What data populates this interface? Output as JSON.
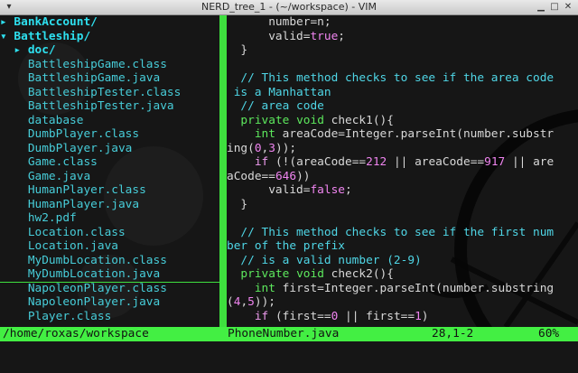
{
  "window": {
    "title": "NERD_tree_1 - (~/workspace) - VIM"
  },
  "tree": {
    "items": [
      {
        "text": "▸ BankAccount/",
        "kind": "dir"
      },
      {
        "text": "▾ Battleship/",
        "kind": "dir"
      },
      {
        "text": "  ▸ doc/",
        "kind": "dir"
      },
      {
        "text": "    BattleshipGame.class",
        "kind": "file"
      },
      {
        "text": "    BattleshipGame.java",
        "kind": "file"
      },
      {
        "text": "    BattleshipTester.class",
        "kind": "file"
      },
      {
        "text": "    BattleshipTester.java",
        "kind": "file"
      },
      {
        "text": "    database",
        "kind": "file"
      },
      {
        "text": "    DumbPlayer.class",
        "kind": "file"
      },
      {
        "text": "    DumbPlayer.java",
        "kind": "file"
      },
      {
        "text": "    Game.class",
        "kind": "file"
      },
      {
        "text": "    Game.java",
        "kind": "file"
      },
      {
        "text": "    HumanPlayer.class",
        "kind": "file"
      },
      {
        "text": "    HumanPlayer.java",
        "kind": "file"
      },
      {
        "text": "    hw2.pdf",
        "kind": "file"
      },
      {
        "text": "    Location.class",
        "kind": "file"
      },
      {
        "text": "    Location.java",
        "kind": "file"
      },
      {
        "text": "    MyDumbLocation.class",
        "kind": "file"
      },
      {
        "text": "    MyDumbLocation.java",
        "kind": "file"
      },
      {
        "text": "    NapoleonPlayer.class",
        "kind": "file"
      },
      {
        "text": "    NapoleonPlayer.java",
        "kind": "file"
      },
      {
        "text": "    Player.class",
        "kind": "file"
      }
    ]
  },
  "code": {
    "lines": [
      [
        {
          "t": "      number=n;",
          "c": "code"
        }
      ],
      [
        {
          "t": "      valid=",
          "c": "code"
        },
        {
          "t": "true",
          "c": "bool"
        },
        {
          "t": ";",
          "c": "code"
        }
      ],
      [
        {
          "t": "  }",
          "c": "code"
        }
      ],
      [
        {
          "t": "",
          "c": "code"
        }
      ],
      [
        {
          "t": "  // This method checks to see if the area code",
          "c": "comment"
        }
      ],
      [
        {
          "t": " is a Manhattan",
          "c": "comment"
        }
      ],
      [
        {
          "t": "  // area code",
          "c": "comment"
        }
      ],
      [
        {
          "t": "  ",
          "c": "code"
        },
        {
          "t": "private",
          "c": "type"
        },
        {
          "t": " ",
          "c": "code"
        },
        {
          "t": "void",
          "c": "type"
        },
        {
          "t": " check1(){",
          "c": "code"
        }
      ],
      [
        {
          "t": "    ",
          "c": "code"
        },
        {
          "t": "int",
          "c": "type"
        },
        {
          "t": " areaCode=Integer.parseInt(number.substr",
          "c": "code"
        }
      ],
      [
        {
          "t": "ing(",
          "c": "code"
        },
        {
          "t": "0",
          "c": "num"
        },
        {
          "t": ",",
          "c": "code"
        },
        {
          "t": "3",
          "c": "num"
        },
        {
          "t": "));",
          "c": "code"
        }
      ],
      [
        {
          "t": "    ",
          "c": "code"
        },
        {
          "t": "if",
          "c": "keyword"
        },
        {
          "t": " (!(areaCode==",
          "c": "code"
        },
        {
          "t": "212",
          "c": "num"
        },
        {
          "t": " || areaCode==",
          "c": "code"
        },
        {
          "t": "917",
          "c": "num"
        },
        {
          "t": " || are",
          "c": "code"
        }
      ],
      [
        {
          "t": "aCode==",
          "c": "code"
        },
        {
          "t": "646",
          "c": "num"
        },
        {
          "t": "))",
          "c": "code"
        }
      ],
      [
        {
          "t": "      valid=",
          "c": "code"
        },
        {
          "t": "false",
          "c": "bool"
        },
        {
          "t": ";",
          "c": "code"
        }
      ],
      [
        {
          "t": "  }",
          "c": "code"
        }
      ],
      [
        {
          "t": "",
          "c": "code"
        }
      ],
      [
        {
          "t": "  // This method checks to see if the first num",
          "c": "comment"
        }
      ],
      [
        {
          "t": "ber of the prefix",
          "c": "comment"
        }
      ],
      [
        {
          "t": "  // is a valid number (2-9)",
          "c": "comment"
        }
      ],
      [
        {
          "t": "  ",
          "c": "code"
        },
        {
          "t": "private",
          "c": "type"
        },
        {
          "t": " ",
          "c": "code"
        },
        {
          "t": "void",
          "c": "type"
        },
        {
          "t": " check2(){",
          "c": "code"
        }
      ],
      [
        {
          "t": "    ",
          "c": "code"
        },
        {
          "t": "int",
          "c": "type"
        },
        {
          "t": " first=Integer.parseInt(number.substring",
          "c": "code"
        }
      ],
      [
        {
          "t": "(",
          "c": "code"
        },
        {
          "t": "4",
          "c": "num"
        },
        {
          "t": ",",
          "c": "code"
        },
        {
          "t": "5",
          "c": "num"
        },
        {
          "t": "));",
          "c": "code"
        }
      ],
      [
        {
          "t": "    ",
          "c": "code"
        },
        {
          "t": "if",
          "c": "keyword"
        },
        {
          "t": " (first==",
          "c": "code"
        },
        {
          "t": "0",
          "c": "num"
        },
        {
          "t": " || first==",
          "c": "code"
        },
        {
          "t": "1",
          "c": "num"
        },
        {
          "t": ")",
          "c": "code"
        }
      ]
    ]
  },
  "status": {
    "path": "/home/roxas/workspace",
    "file": "PhoneNumber.java",
    "position": "28,1-2",
    "percent": "60%"
  },
  "colors": {
    "statusbar": "#43ef43",
    "split": "#3ee03e",
    "tree_dir": "#2ee0ef",
    "comment": "#4fd6e6"
  }
}
